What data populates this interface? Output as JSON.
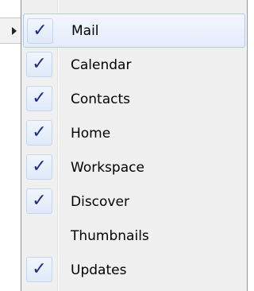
{
  "menu": {
    "items": [
      {
        "label": "Mail",
        "checked": true,
        "highlighted": true
      },
      {
        "label": "Calendar",
        "checked": true,
        "highlighted": false
      },
      {
        "label": "Contacts",
        "checked": true,
        "highlighted": false
      },
      {
        "label": "Home",
        "checked": true,
        "highlighted": false
      },
      {
        "label": "Workspace",
        "checked": true,
        "highlighted": false
      },
      {
        "label": "Discover",
        "checked": true,
        "highlighted": false
      },
      {
        "label": "Thumbnails",
        "checked": false,
        "highlighted": false
      },
      {
        "label": "Updates",
        "checked": true,
        "highlighted": false
      }
    ],
    "check_glyph": "✓"
  },
  "colors": {
    "menu_background": "#f0f0f0",
    "highlight_border": "#aeccf2",
    "check_color": "#1b2c86"
  },
  "icons": {
    "submenu_indicator": "chevron-right-icon"
  }
}
